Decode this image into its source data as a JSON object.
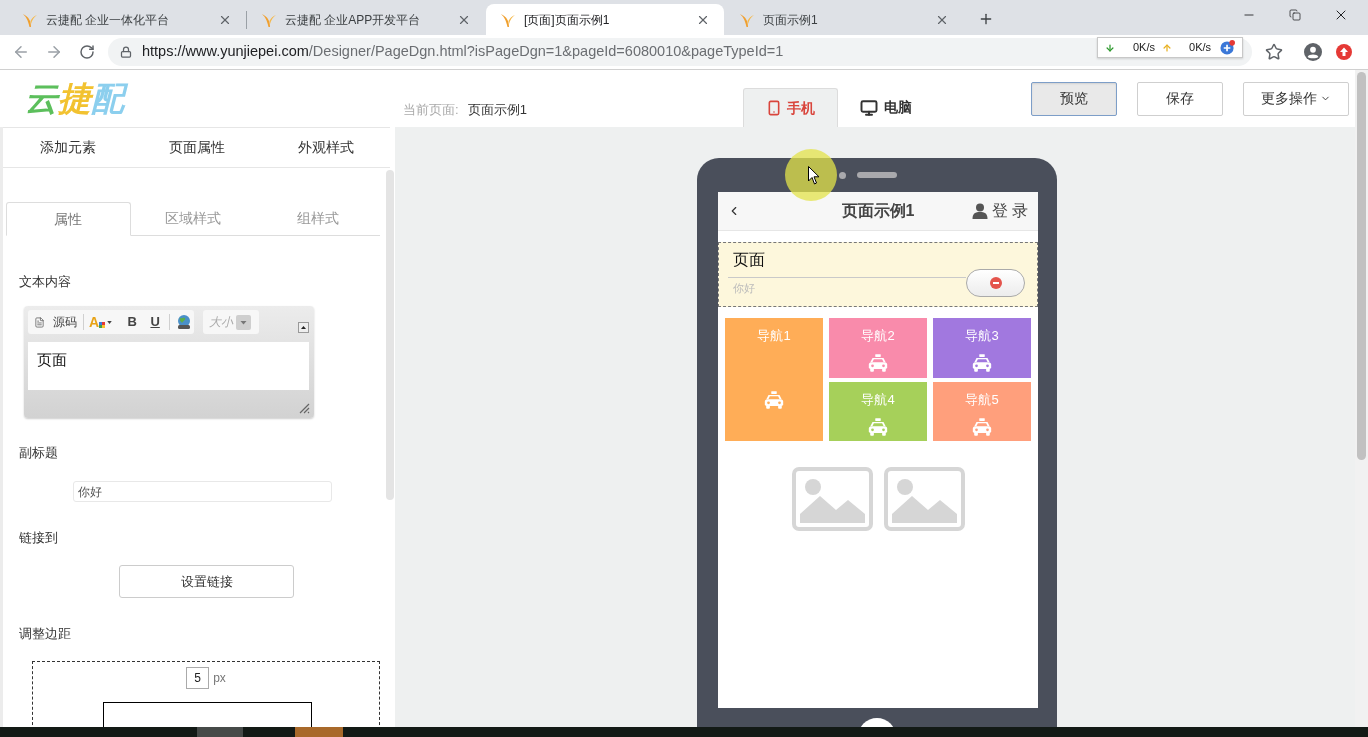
{
  "browser": {
    "tabs": [
      {
        "title": "云捷配 企业一体化平台",
        "selected": false
      },
      {
        "title": "云捷配 企业APP开发平台",
        "selected": false
      },
      {
        "title": "[页面]页面示例1",
        "selected": true
      },
      {
        "title": "页面示例1",
        "selected": false
      }
    ],
    "address": {
      "host": "https://www.yunjiepei.com",
      "path": "/Designer/PageDgn.html?isPageDgn=1&pageId=6080010&pageTypeId=1"
    },
    "net_speed": {
      "download": "0K/s",
      "upload": "0K/s"
    }
  },
  "header": {
    "logo": "云捷配",
    "current_page_label": "当前页面:",
    "current_page": "页面示例1",
    "device_tabs": [
      {
        "label": "手机",
        "kind": "phone",
        "selected": true
      },
      {
        "label": "电脑",
        "kind": "desktop",
        "selected": false
      }
    ],
    "buttons": [
      {
        "label": "预览",
        "focused": true
      },
      {
        "label": "保存",
        "focused": false
      },
      {
        "label": "更多操作",
        "focused": false,
        "dropdown": true
      }
    ]
  },
  "left_panel": {
    "main_tabs": [
      {
        "label": "添加元素",
        "selected": false
      },
      {
        "label": "页面属性",
        "selected": false
      },
      {
        "label": "外观样式",
        "selected": false
      }
    ],
    "sub_tabs": [
      {
        "label": "属性",
        "selected": true
      },
      {
        "label": "区域样式",
        "selected": false
      },
      {
        "label": "组样式",
        "selected": false
      }
    ],
    "text_content": {
      "label": "文本内容",
      "toolbar": {
        "source": "源码",
        "font_color": "A",
        "bold": "B",
        "underline": "U",
        "font_size": {
          "placeholder": "大小"
        }
      },
      "value": "页面"
    },
    "subtitle": {
      "label": "副标题",
      "value": "你好"
    },
    "link": {
      "label": "链接到",
      "button": "设置链接"
    },
    "margin": {
      "label": "调整边距",
      "value": "5",
      "unit": "px"
    }
  },
  "phone": {
    "title": "页面示例1",
    "login": "登 录",
    "section": {
      "title": "页面",
      "subtitle": "你好"
    },
    "nav": [
      {
        "label": "导航1",
        "color": "#ffad57"
      },
      {
        "label": "导航2",
        "color": "#f98bab"
      },
      {
        "label": "导航3",
        "color": "#a178df"
      },
      {
        "label": "导航4",
        "color": "#a6d05a"
      },
      {
        "label": "导航5",
        "color": "#ff9f7c"
      }
    ]
  }
}
